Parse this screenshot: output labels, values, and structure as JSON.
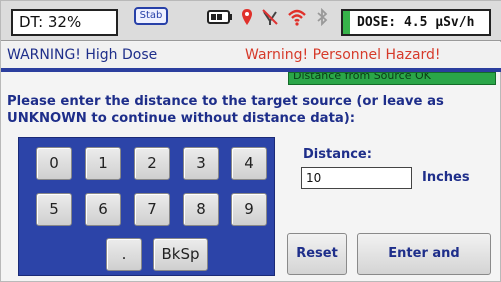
{
  "status": {
    "dt_label": "DT: 32%",
    "stab_label": "Stab",
    "dose_label": "DOSE: 4.5  µSv/h",
    "dose_indicator_color": "#37b34a",
    "icons": [
      "battery-icon",
      "gps-pin-icon",
      "muted-signal-icon",
      "wifi-icon",
      "bluetooth-icon"
    ]
  },
  "warnings": {
    "left": "WARNING! High Dose",
    "right": "Warning! Personnel Hazard!"
  },
  "distance_status": "Distance from Source OK",
  "prompt": "Please enter the distance to the target source (or leave as UNKNOWN to continue without distance data):",
  "keypad": {
    "row1": [
      "0",
      "1",
      "2",
      "3",
      "4"
    ],
    "row2": [
      "5",
      "6",
      "7",
      "8",
      "9"
    ],
    "dot": ".",
    "backspace": "BkSp"
  },
  "distance": {
    "label": "Distance:",
    "value": "10",
    "unit": "Inches"
  },
  "buttons": {
    "reset": "Reset",
    "enter": "Enter and Continue"
  }
}
